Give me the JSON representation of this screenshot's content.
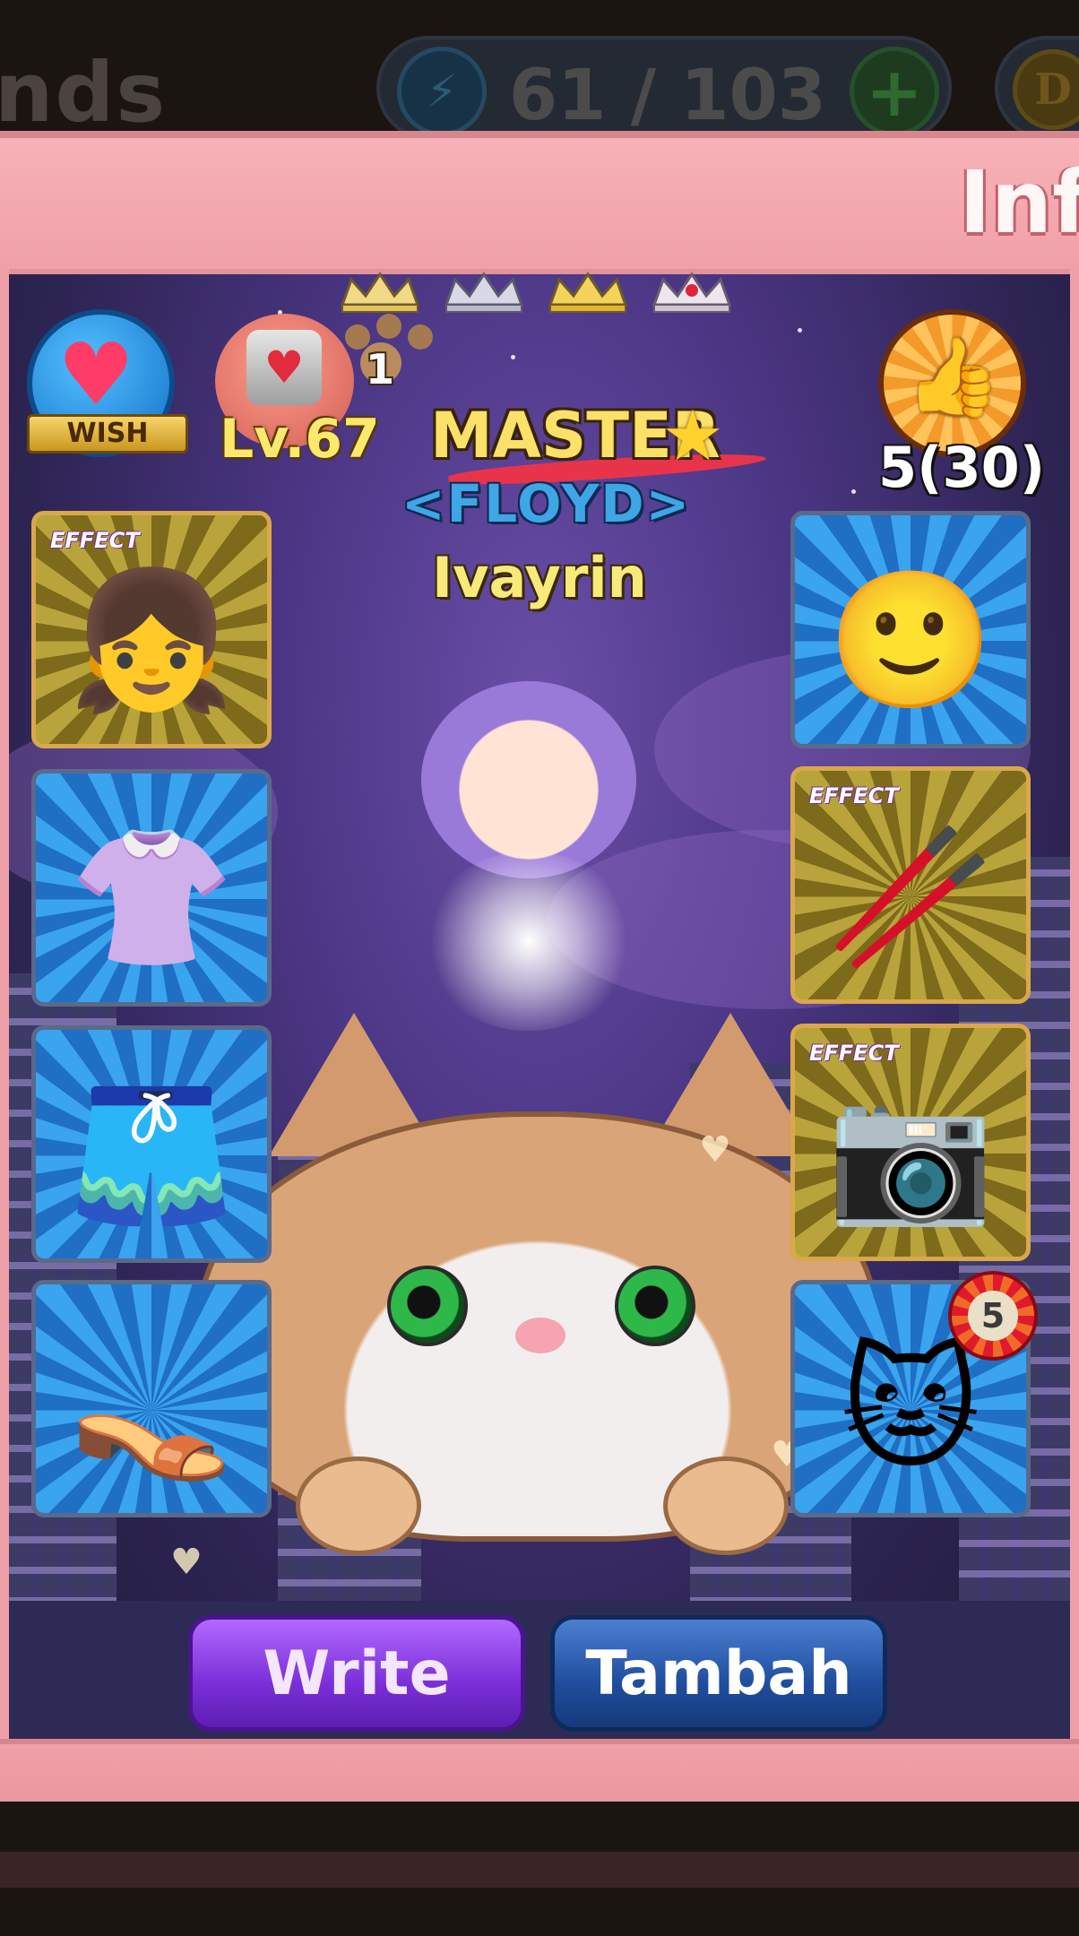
{
  "topbar": {
    "title_partial": "nds",
    "energy": {
      "icon": "energy-icon",
      "count": "61 / 103",
      "add_icon": "plus-icon"
    },
    "coin": {
      "icon": "coin-icon",
      "symbol": "D"
    }
  },
  "panel": {
    "title_partial": "Inf"
  },
  "profile": {
    "wish_label": "WISH",
    "level": "Lv.67",
    "paw_count": "1",
    "rank": "MASTER",
    "guild": "<FLOYD>",
    "name": "Ivayrin",
    "likes": "5(30)"
  },
  "slots": {
    "effect_label": "EFFECT",
    "left": [
      {
        "name": "hair-slot",
        "icon": "hair-icon",
        "effect": true
      },
      {
        "name": "top-slot",
        "icon": "shirt-icon",
        "effect": false
      },
      {
        "name": "bottom-slot",
        "icon": "shorts-icon",
        "effect": false
      },
      {
        "name": "shoes-slot",
        "icon": "shoes-icon",
        "effect": false
      }
    ],
    "right": [
      {
        "name": "face-slot",
        "icon": "face-icon",
        "effect": false
      },
      {
        "name": "weapon-slot",
        "icon": "drumsticks-icon",
        "effect": true
      },
      {
        "name": "accessory-slot",
        "icon": "camera-necklace-icon",
        "effect": true
      },
      {
        "name": "pet-slot",
        "icon": "cat-pet-icon",
        "effect": false,
        "rank": "5"
      }
    ]
  },
  "buttons": {
    "write": "Write",
    "add": "Tambah"
  },
  "colors": {
    "frame_pink": "#f0a0a8",
    "write_purple": "#7a2ed8",
    "tambah_blue": "#1f4d9e",
    "rank_gold": "#fbe06a",
    "guild_blue": "#3fa6e6"
  }
}
